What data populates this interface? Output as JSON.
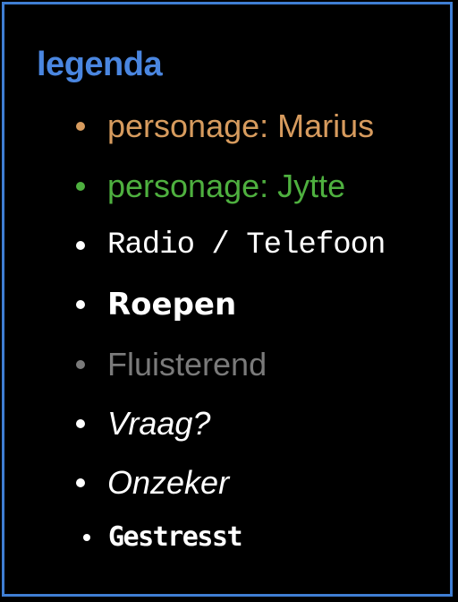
{
  "legend": {
    "title": "legenda",
    "title_color": "#4a86e0",
    "border_color": "#3f7ed3",
    "items": [
      {
        "label": "personage: Marius",
        "color": "#d79b5e",
        "style": "regular"
      },
      {
        "label": "personage: Jytte",
        "color": "#4eb03f",
        "style": "regular"
      },
      {
        "label": "Radio / Telefoon",
        "color": "#ffffff",
        "style": "pixel/monospace"
      },
      {
        "label": "Roepen",
        "color": "#ffffff",
        "style": "bold"
      },
      {
        "label": "Fluisterend",
        "color": "#7a7a7a",
        "style": "light"
      },
      {
        "label": "Vraag?",
        "color": "#ffffff",
        "style": "italic"
      },
      {
        "label": "Onzeker",
        "color": "#ffffff",
        "style": "italic"
      },
      {
        "label": "Gestresst",
        "color": "#ffffff",
        "style": "jittery"
      }
    ]
  }
}
